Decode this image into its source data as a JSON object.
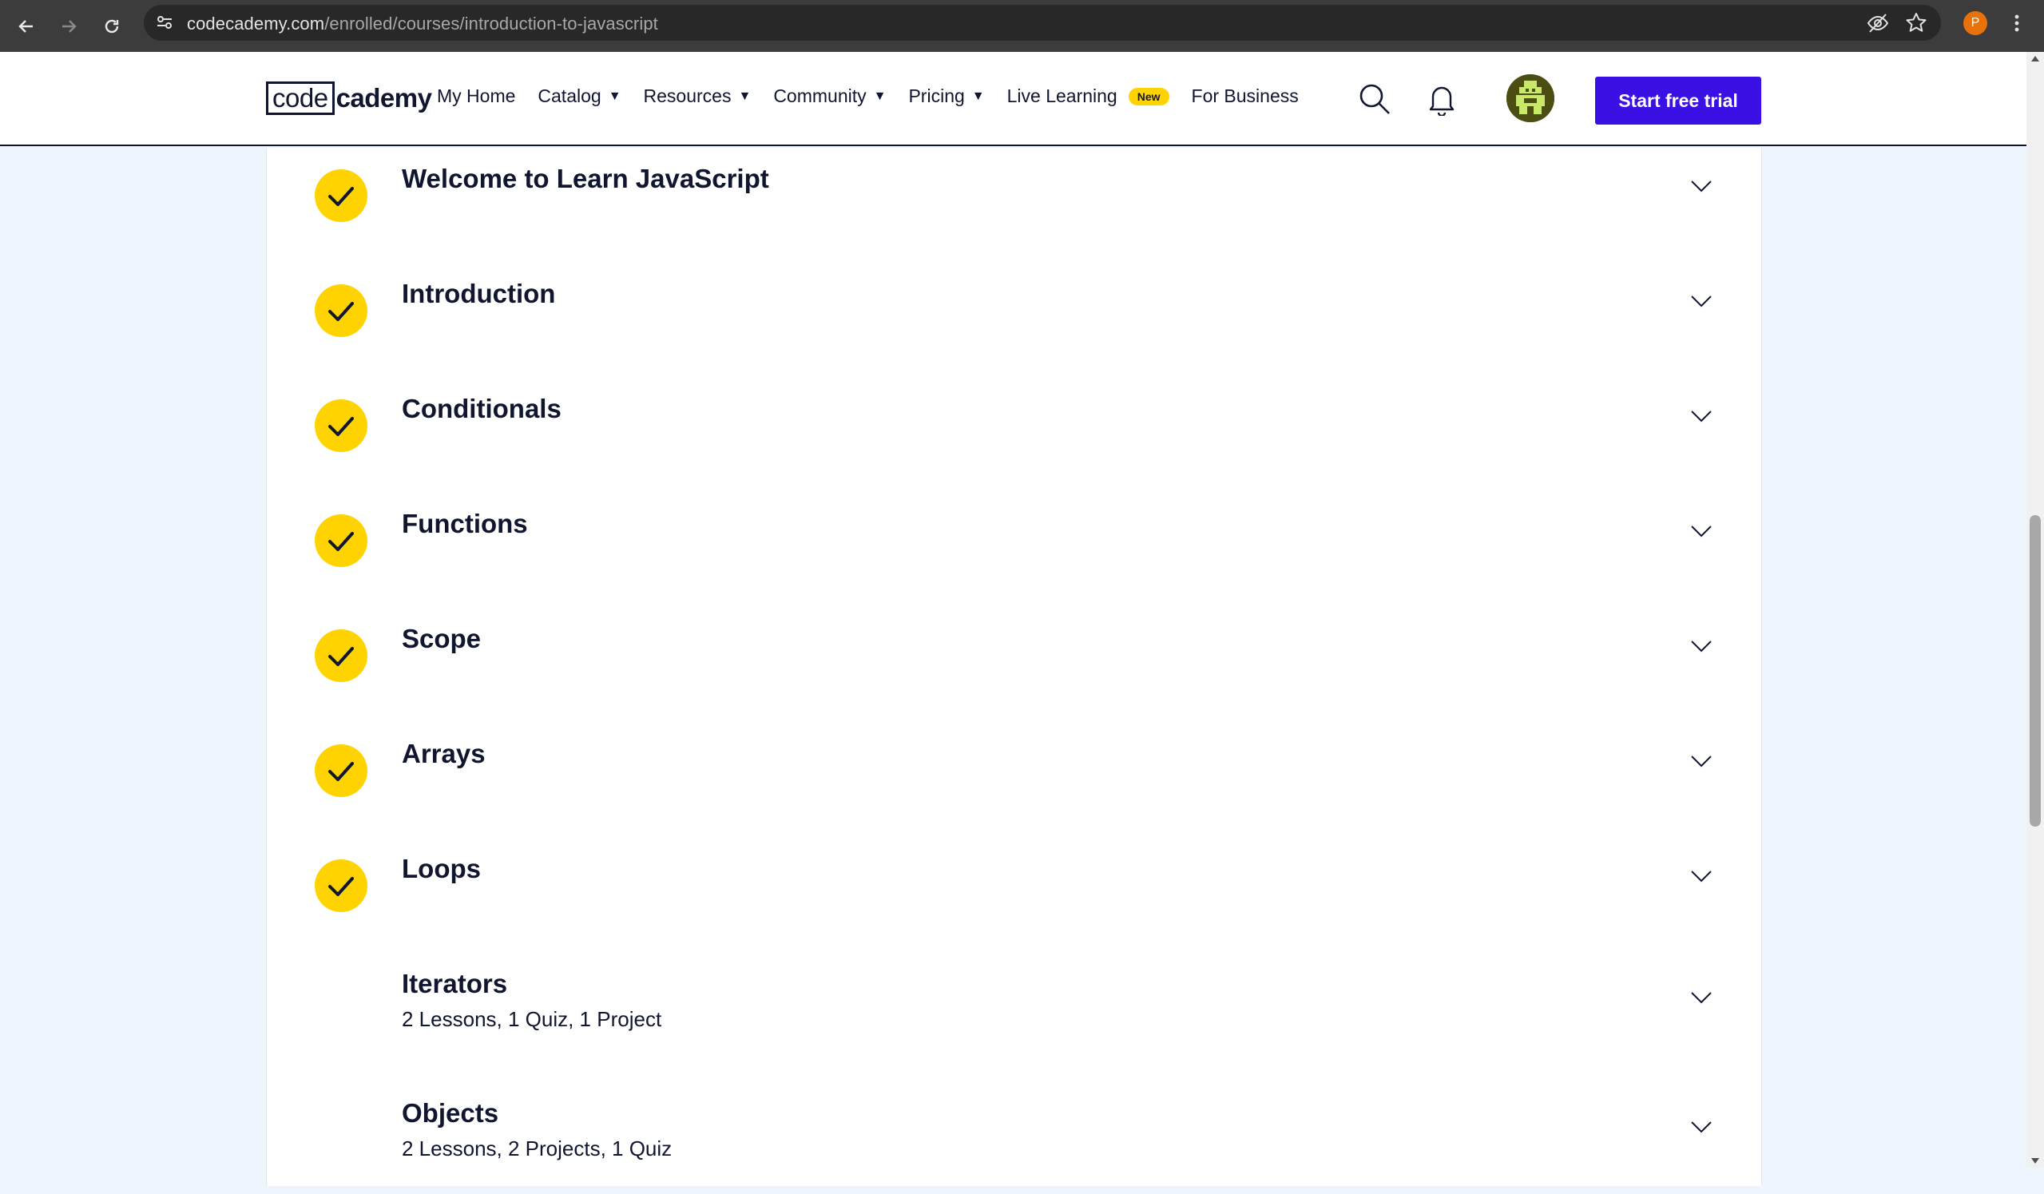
{
  "browser": {
    "url_host": "codecademy.com",
    "url_path": "/enrolled/courses/introduction-to-javascript",
    "profile_initial": "P"
  },
  "header": {
    "logo_code": "code",
    "logo_rest": "cademy",
    "nav": {
      "my_home": "My Home",
      "catalog": "Catalog",
      "resources": "Resources",
      "community": "Community",
      "pricing": "Pricing",
      "live_learning": "Live Learning",
      "live_learning_badge": "New",
      "for_business": "For Business"
    },
    "cta": "Start free trial"
  },
  "modules": [
    {
      "title": "Welcome to Learn JavaScript",
      "completed": true,
      "meta": ""
    },
    {
      "title": "Introduction",
      "completed": true,
      "meta": ""
    },
    {
      "title": "Conditionals",
      "completed": true,
      "meta": ""
    },
    {
      "title": "Functions",
      "completed": true,
      "meta": ""
    },
    {
      "title": "Scope",
      "completed": true,
      "meta": ""
    },
    {
      "title": "Arrays",
      "completed": true,
      "meta": ""
    },
    {
      "title": "Loops",
      "completed": true,
      "meta": ""
    },
    {
      "title": "Iterators",
      "completed": false,
      "meta": "2 Lessons, 1 Quiz, 1 Project"
    },
    {
      "title": "Objects",
      "completed": false,
      "meta": "2 Lessons, 2 Projects, 1 Quiz"
    }
  ],
  "colors": {
    "accent": "#3a10e5",
    "check": "#ffd300",
    "text": "#10162f",
    "page_bg": "#eef5fc"
  }
}
